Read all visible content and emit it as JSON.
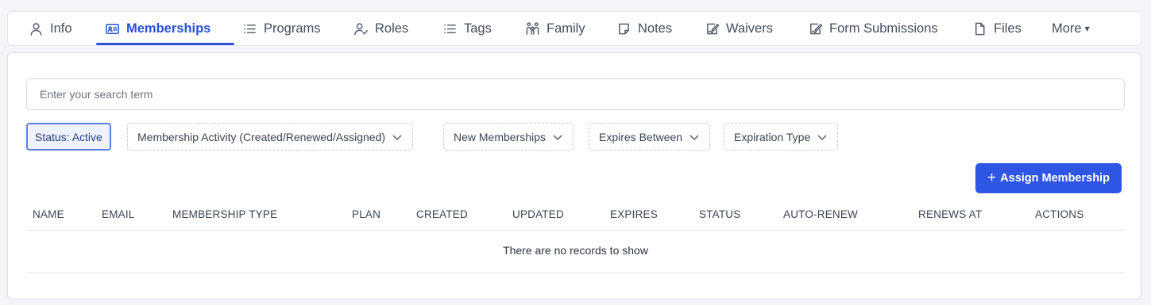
{
  "tabs": [
    {
      "label": "Info",
      "icon": "user-icon",
      "active": false
    },
    {
      "label": "Memberships",
      "icon": "id-card-icon",
      "active": true
    },
    {
      "label": "Programs",
      "icon": "list-icon",
      "active": false
    },
    {
      "label": "Roles",
      "icon": "user-check-icon",
      "active": false
    },
    {
      "label": "Tags",
      "icon": "list-icon",
      "active": false
    },
    {
      "label": "Family",
      "icon": "family-icon",
      "active": false
    },
    {
      "label": "Notes",
      "icon": "note-icon",
      "active": false
    },
    {
      "label": "Waivers",
      "icon": "signature-icon",
      "active": false
    },
    {
      "label": "Form Submissions",
      "icon": "signature-icon",
      "active": false
    },
    {
      "label": "Files",
      "icon": "file-icon",
      "active": false
    },
    {
      "label": "More",
      "icon": "caret-down-icon",
      "active": false
    }
  ],
  "more_caret": "▾",
  "search": {
    "placeholder": "Enter your search term",
    "value": ""
  },
  "filters": [
    {
      "label": "Status: Active",
      "active": true
    },
    {
      "label": "Membership Activity (Created/Renewed/Assigned)",
      "active": false
    },
    {
      "label": "New Memberships",
      "active": false
    },
    {
      "label": "Expires Between",
      "active": false
    },
    {
      "label": "Expiration Type",
      "active": false
    }
  ],
  "assign_button": {
    "plus": "+",
    "label": "Assign Membership"
  },
  "table": {
    "columns": [
      "NAME",
      "EMAIL",
      "MEMBERSHIP TYPE",
      "PLAN",
      "CREATED",
      "UPDATED",
      "EXPIRES",
      "STATUS",
      "AUTO-RENEW",
      "RENEWS AT",
      "ACTIONS"
    ],
    "empty_message": "There are no records to show"
  },
  "colors": {
    "accent": "#2f55e4",
    "active_tab": "#2751d8"
  }
}
